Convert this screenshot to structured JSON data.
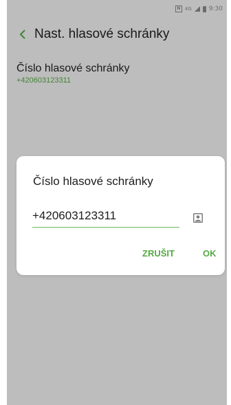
{
  "status_bar": {
    "time": "9:30",
    "icons": [
      "nfc-icon",
      "data-icon",
      "signal-icon",
      "battery-icon"
    ]
  },
  "app_bar": {
    "back_icon": "chevron-left-icon",
    "title": "Nast. hlasové schránky"
  },
  "preference": {
    "title": "Číslo hlasové schránky",
    "summary": "+420603123311"
  },
  "dialog": {
    "title": "Číslo hlasové schránky",
    "input_value": "+420603123311",
    "contact_icon": "contact-card-icon",
    "cancel_label": "ZRUŠIT",
    "ok_label": "OK"
  },
  "colors": {
    "accent": "#55a843",
    "underline": "#6cb85c",
    "background": "#f2f2f2",
    "scrim": "rgba(0,0,0,0.22)"
  }
}
